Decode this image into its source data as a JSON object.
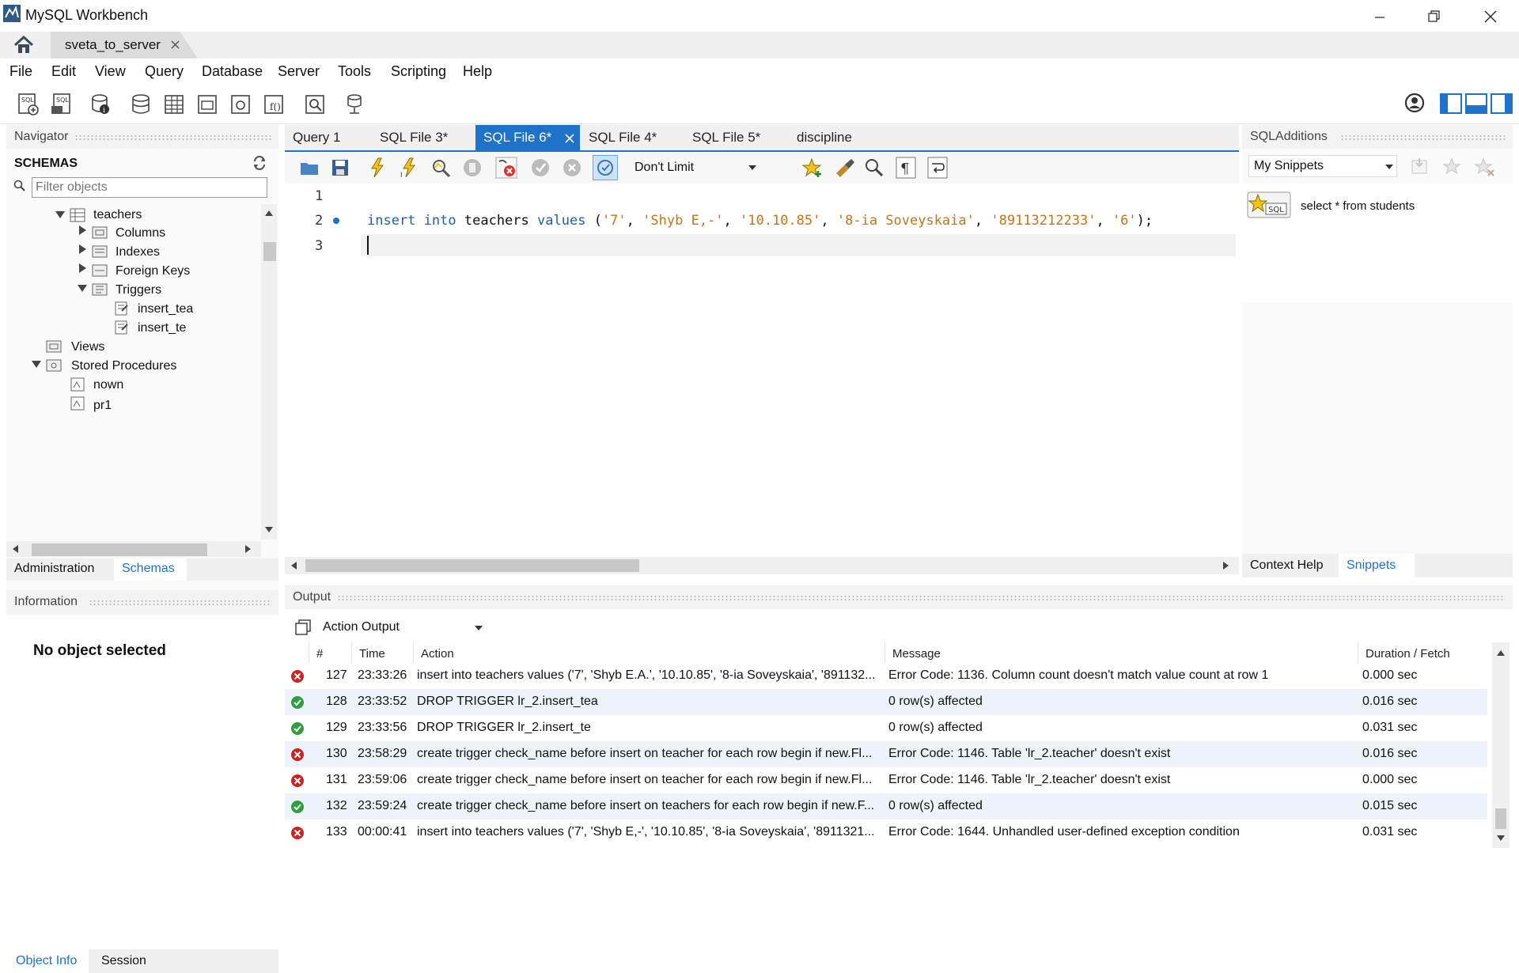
{
  "window": {
    "title": "MySQL Workbench"
  },
  "connection_tab": {
    "label": "sveta_to_server"
  },
  "menu": [
    "File",
    "Edit",
    "View",
    "Query",
    "Database",
    "Server",
    "Tools",
    "Scripting",
    "Help"
  ],
  "navigator": {
    "title": "Navigator",
    "schemas_label": "SCHEMAS",
    "filter_placeholder": "Filter objects",
    "tree": {
      "teachers": "teachers",
      "columns": "Columns",
      "indexes": "Indexes",
      "foreign_keys": "Foreign Keys",
      "triggers": "Triggers",
      "trigger1": "insert_tea",
      "trigger2": "insert_te",
      "views": "Views",
      "stored_procedures": "Stored Procedures",
      "proc1": "nown",
      "proc2": "pr1"
    },
    "tabs": {
      "administration": "Administration",
      "schemas": "Schemas"
    },
    "information_title": "Information",
    "no_object": "No object selected",
    "bottom_tabs": {
      "object_info": "Object Info",
      "session": "Session"
    }
  },
  "editor": {
    "tabs": [
      "Query 1",
      "SQL File 3*",
      "SQL File 6*",
      "SQL File 4*",
      "SQL File 5*",
      "discipline"
    ],
    "limit": "Don't Limit",
    "line_numbers": [
      "1",
      "2",
      "3"
    ],
    "code": {
      "kw1": "insert",
      "kw2": "into",
      "table": "teachers",
      "kw3": "values",
      "open": "(",
      "v1": "'7'",
      "v2": "'Shyb E,-'",
      "v3": "'10.10.85'",
      "v4": "'8-ia Soveyskaia'",
      "v5": "'89113212233'",
      "v6": "'6'",
      "close": ");",
      "comma": ","
    }
  },
  "sql_additions": {
    "title": "SQLAdditions",
    "snippets_select": "My Snippets",
    "snippet": "select * from students",
    "tabs": {
      "context_help": "Context Help",
      "snippets": "Snippets"
    }
  },
  "output": {
    "title": "Output",
    "mode": "Action Output",
    "columns": {
      "num": "#",
      "time": "Time",
      "action": "Action",
      "message": "Message",
      "duration": "Duration / Fetch"
    },
    "rows": [
      {
        "status": "error",
        "num": "127",
        "time": "23:33:26",
        "action": "insert into teachers values ('7', 'Shyb E.A.', '10.10.85', '8-ia Soveyskaia', '891132...",
        "message": "Error Code: 1136. Column count doesn't match value count at row 1",
        "duration": "0.000 sec"
      },
      {
        "status": "ok",
        "num": "128",
        "time": "23:33:52",
        "action": "DROP TRIGGER lr_2.insert_tea",
        "message": "0 row(s) affected",
        "duration": "0.016 sec"
      },
      {
        "status": "ok",
        "num": "129",
        "time": "23:33:56",
        "action": "DROP TRIGGER lr_2.insert_te",
        "message": "0 row(s) affected",
        "duration": "0.031 sec"
      },
      {
        "status": "error",
        "num": "130",
        "time": "23:58:29",
        "action": "create trigger check_name before insert on teacher for each row begin if new.Fl...",
        "message": "Error Code: 1146. Table 'lr_2.teacher' doesn't exist",
        "duration": "0.016 sec"
      },
      {
        "status": "error",
        "num": "131",
        "time": "23:59:06",
        "action": "create trigger check_name before insert on teacher for each row begin if new.Fl...",
        "message": "Error Code: 1146. Table 'lr_2.teacher' doesn't exist",
        "duration": "0.000 sec"
      },
      {
        "status": "ok",
        "num": "132",
        "time": "23:59:24",
        "action": "create trigger check_name before insert on teachers for each row begin if new.F...",
        "message": "0 row(s) affected",
        "duration": "0.015 sec"
      },
      {
        "status": "error",
        "num": "133",
        "time": "00:00:41",
        "action": "insert into teachers values ('7', 'Shyb E,-', '10.10.85', '8-ia Soveyskaia', '8911321...",
        "message": "Error Code: 1644. Unhandled user-defined exception condition",
        "duration": "0.031 sec"
      }
    ]
  },
  "colors": {
    "accent": "#1e73c8",
    "ok": "#2e9e3e",
    "error": "#cc2222",
    "keyword": "#1f5fa8",
    "string": "#c2761a"
  }
}
